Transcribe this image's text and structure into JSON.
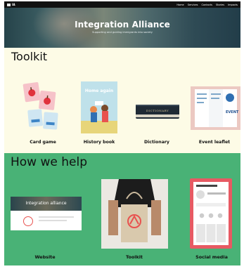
{
  "nav": {
    "logo": "IA",
    "links": [
      "Home",
      "Services",
      "Contacts",
      "Stories",
      "Impacts"
    ]
  },
  "hero": {
    "title": "Integration Alliance",
    "subtitle": "Supporting and guiding immigrants into society"
  },
  "toolkit": {
    "title": "Toolkit",
    "items": [
      {
        "label": "Card game",
        "icon": "card-game-image"
      },
      {
        "label": "History book",
        "icon": "history-book-image"
      },
      {
        "label": "Dictionary",
        "icon": "dictionary-image"
      },
      {
        "label": "Event leaflet",
        "icon": "event-leaflet-image"
      }
    ],
    "book_cover_title": "Home again",
    "dictionary_spine": "DICTIONARY",
    "leaflet_word": "EVENT"
  },
  "help": {
    "title": "How we help",
    "items": [
      {
        "label": "Website",
        "icon": "website-image"
      },
      {
        "label": "Toolkit",
        "icon": "tote-bag-image"
      },
      {
        "label": "Social media",
        "icon": "social-media-image"
      }
    ],
    "website_mock_title": "Integration alliance"
  },
  "colors": {
    "toolkit_bg": "#fdfbe6",
    "help_bg": "#49b276",
    "nav_bg": "#111111",
    "accent_red": "#e8524f"
  }
}
